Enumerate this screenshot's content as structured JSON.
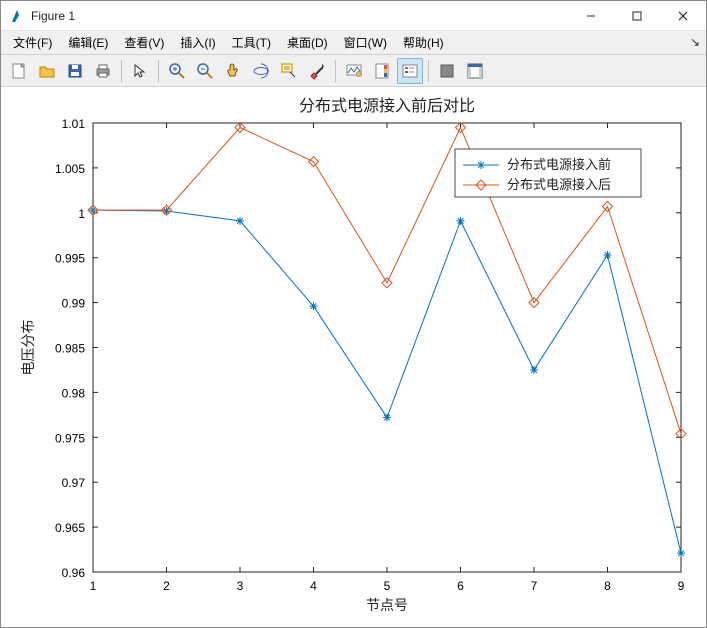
{
  "window": {
    "title": "Figure 1",
    "min_label": "—",
    "max_label": "□",
    "close_label": "✕"
  },
  "menubar": {
    "items": [
      "文件(F)",
      "编辑(E)",
      "查看(V)",
      "插入(I)",
      "工具(T)",
      "桌面(D)",
      "窗口(W)",
      "帮助(H)"
    ]
  },
  "toolbar": {
    "icons": [
      "new-figure-icon",
      "open-icon",
      "save-icon",
      "print-icon",
      "|",
      "pointer-icon",
      "|",
      "zoom-in-icon",
      "zoom-out-icon",
      "pan-icon",
      "rotate3d-icon",
      "data-cursor-icon",
      "brush-icon",
      "|",
      "link-icon",
      "colorbar-icon",
      "legend-icon",
      "|",
      "hide-plot-tools-icon",
      "show-plot-tools-icon"
    ],
    "active_index": 15
  },
  "chart_data": {
    "type": "line",
    "title": "分布式电源接入前后对比",
    "xlabel": "节点号",
    "ylabel": "电压分布",
    "x": [
      1,
      2,
      3,
      4,
      5,
      6,
      7,
      8,
      9
    ],
    "xlim": [
      1,
      9
    ],
    "ylim": [
      0.96,
      1.01
    ],
    "yticks": [
      0.96,
      0.965,
      0.97,
      0.975,
      0.98,
      0.985,
      0.99,
      0.995,
      1,
      1.005,
      1.01
    ],
    "xticks": [
      1,
      2,
      3,
      4,
      5,
      6,
      7,
      8,
      9
    ],
    "series": [
      {
        "name": "分布式电源接入前",
        "color": "#0072BD",
        "marker": "asterisk",
        "values": [
          1.0003,
          1.0002,
          0.9991,
          0.9896,
          0.9772,
          0.9991,
          0.9825,
          0.9953,
          0.9621
        ]
      },
      {
        "name": "分布式电源接入后",
        "color": "#D95319",
        "marker": "diamond",
        "values": [
          1.0003,
          1.0003,
          1.0095,
          1.0057,
          0.9922,
          1.0095,
          0.99,
          1.0007,
          0.9754
        ]
      }
    ],
    "legend": {
      "position": "upper-right",
      "items": [
        "分布式电源接入前",
        "分布式电源接入后"
      ]
    },
    "grid": false
  },
  "colors": {
    "series_before": "#0072BD",
    "series_after": "#D95319",
    "axis": "#222222",
    "toolbar_bg": "#f0f0f0"
  }
}
